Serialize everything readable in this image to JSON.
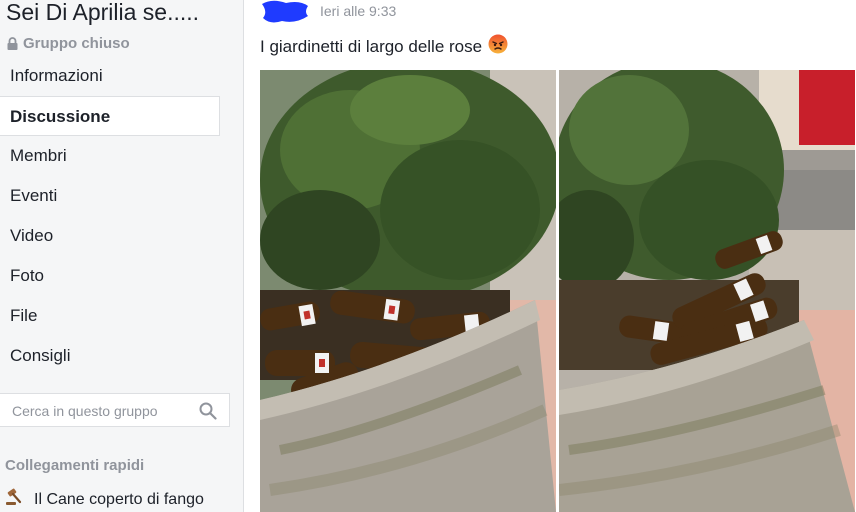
{
  "group": {
    "title": "Sei Di Aprilia se.....",
    "privacy": "Gruppo chiuso",
    "lock_icon": "lock-icon"
  },
  "nav": {
    "items": [
      {
        "label": "Informazioni"
      },
      {
        "label": "Discussione",
        "active": true
      },
      {
        "label": "Membri"
      },
      {
        "label": "Eventi"
      },
      {
        "label": "Video"
      },
      {
        "label": "Foto"
      },
      {
        "label": "File"
      },
      {
        "label": "Consigli"
      }
    ]
  },
  "search": {
    "placeholder": "Cerca in questo gruppo",
    "icon": "search-icon"
  },
  "quick_links": {
    "title": "Collegamenti rapidi",
    "items": [
      {
        "label": "Il Cane coperto di fango",
        "icon": "gavel-icon"
      }
    ]
  },
  "post": {
    "timestamp": "Ieri alle 9:33",
    "text": "I giardinetti di largo delle rose",
    "emoji": "angry-face-icon",
    "photos": [
      {
        "description_icon": "photo-planter-bottles-1"
      },
      {
        "description_icon": "photo-planter-bottles-2"
      }
    ]
  },
  "colors": {
    "sidebar_bg": "#f5f6f7",
    "border": "#dddfe2",
    "muted_text": "#90949c",
    "avatar_blue": "#1f3bff"
  }
}
